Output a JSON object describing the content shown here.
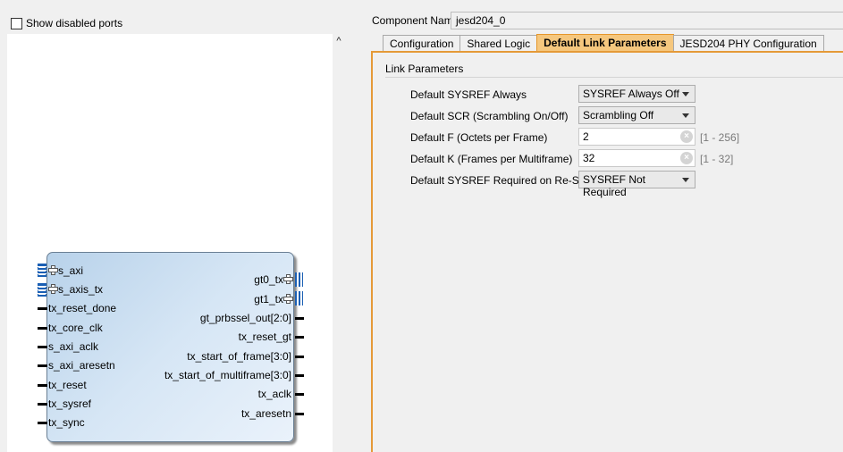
{
  "left": {
    "show_disabled_ports": "Show disabled ports",
    "scroll_up": "^",
    "ip_block": {
      "left_ports": [
        {
          "name": "s_axi",
          "type": "bus"
        },
        {
          "name": "s_axis_tx",
          "type": "bus"
        },
        {
          "name": "tx_reset_done",
          "type": "pin"
        },
        {
          "name": "tx_core_clk",
          "type": "pin"
        },
        {
          "name": "s_axi_aclk",
          "type": "pin"
        },
        {
          "name": "s_axi_aresetn",
          "type": "pin"
        },
        {
          "name": "tx_reset",
          "type": "pin"
        },
        {
          "name": "tx_sysref",
          "type": "pin"
        },
        {
          "name": "tx_sync",
          "type": "pin"
        }
      ],
      "right_ports": [
        {
          "name": "gt0_tx",
          "type": "bus"
        },
        {
          "name": "gt1_tx",
          "type": "bus"
        },
        {
          "name": "gt_prbssel_out[2:0]",
          "type": "pin"
        },
        {
          "name": "tx_reset_gt",
          "type": "pin"
        },
        {
          "name": "tx_start_of_frame[3:0]",
          "type": "pin"
        },
        {
          "name": "tx_start_of_multiframe[3:0]",
          "type": "pin"
        },
        {
          "name": "tx_aclk",
          "type": "pin"
        },
        {
          "name": "tx_aresetn",
          "type": "pin"
        }
      ]
    }
  },
  "right": {
    "component_name_label": "Component Name",
    "component_name_value": "jesd204_0",
    "tabs": [
      {
        "label": "Configuration",
        "active": false
      },
      {
        "label": "Shared Logic",
        "active": false
      },
      {
        "label": "Default Link Parameters",
        "active": true
      },
      {
        "label": "JESD204 PHY Configuration",
        "active": false
      }
    ],
    "group_title": "Link Parameters",
    "params": [
      {
        "label": "Default SYSREF Always",
        "kind": "dropdown",
        "value": "SYSREF Always Off"
      },
      {
        "label": "Default SCR (Scrambling On/Off)",
        "kind": "dropdown",
        "value": "Scrambling Off"
      },
      {
        "label": "Default F (Octets per Frame)",
        "kind": "text",
        "value": "2",
        "range": "[1 - 256]"
      },
      {
        "label": "Default K (Frames per Multiframe)",
        "kind": "text",
        "value": "32",
        "range": "[1 - 32]"
      },
      {
        "label": "Default SYSREF Required on Re-Sync",
        "kind": "dropdown",
        "value": "SYSREF Not Required"
      }
    ],
    "colors": {
      "active_tab": "#f5c77e",
      "accent_border": "#e59a38"
    }
  }
}
